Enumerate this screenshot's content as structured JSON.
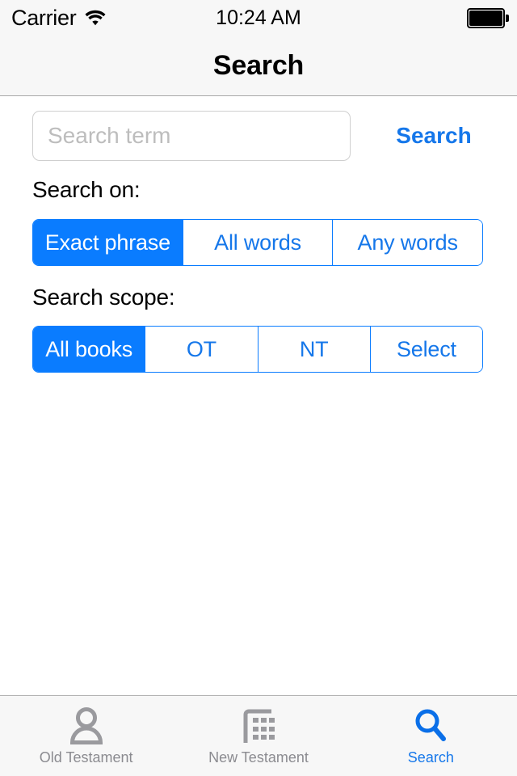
{
  "statusbar": {
    "carrier": "Carrier",
    "wifi_icon": "wifi-icon",
    "time": "10:24 AM",
    "battery_icon": "battery-full-icon"
  },
  "navbar": {
    "title": "Search"
  },
  "search": {
    "placeholder": "Search term",
    "value": "",
    "submit_label": "Search"
  },
  "search_on": {
    "label": "Search on:",
    "options": [
      {
        "label": "Exact phrase",
        "selected": true
      },
      {
        "label": "All words",
        "selected": false
      },
      {
        "label": "Any words",
        "selected": false
      }
    ]
  },
  "search_scope": {
    "label": "Search scope:",
    "options": [
      {
        "label": "All books",
        "selected": true
      },
      {
        "label": "OT",
        "selected": false
      },
      {
        "label": "NT",
        "selected": false
      },
      {
        "label": "Select",
        "selected": false
      }
    ]
  },
  "tabbar": {
    "items": [
      {
        "label": "Old Testament",
        "icon": "person-icon",
        "active": false
      },
      {
        "label": "New Testament",
        "icon": "building-grid-icon",
        "active": false
      },
      {
        "label": "Search",
        "icon": "magnifier-icon",
        "active": true
      }
    ]
  },
  "colors": {
    "accent": "#0a7cff",
    "accent_text": "#1577ea",
    "chrome_bg": "#f7f7f7",
    "content_bg": "#ffffff",
    "inactive_tab": "#8b8b90",
    "placeholder": "#bdbdbd"
  }
}
